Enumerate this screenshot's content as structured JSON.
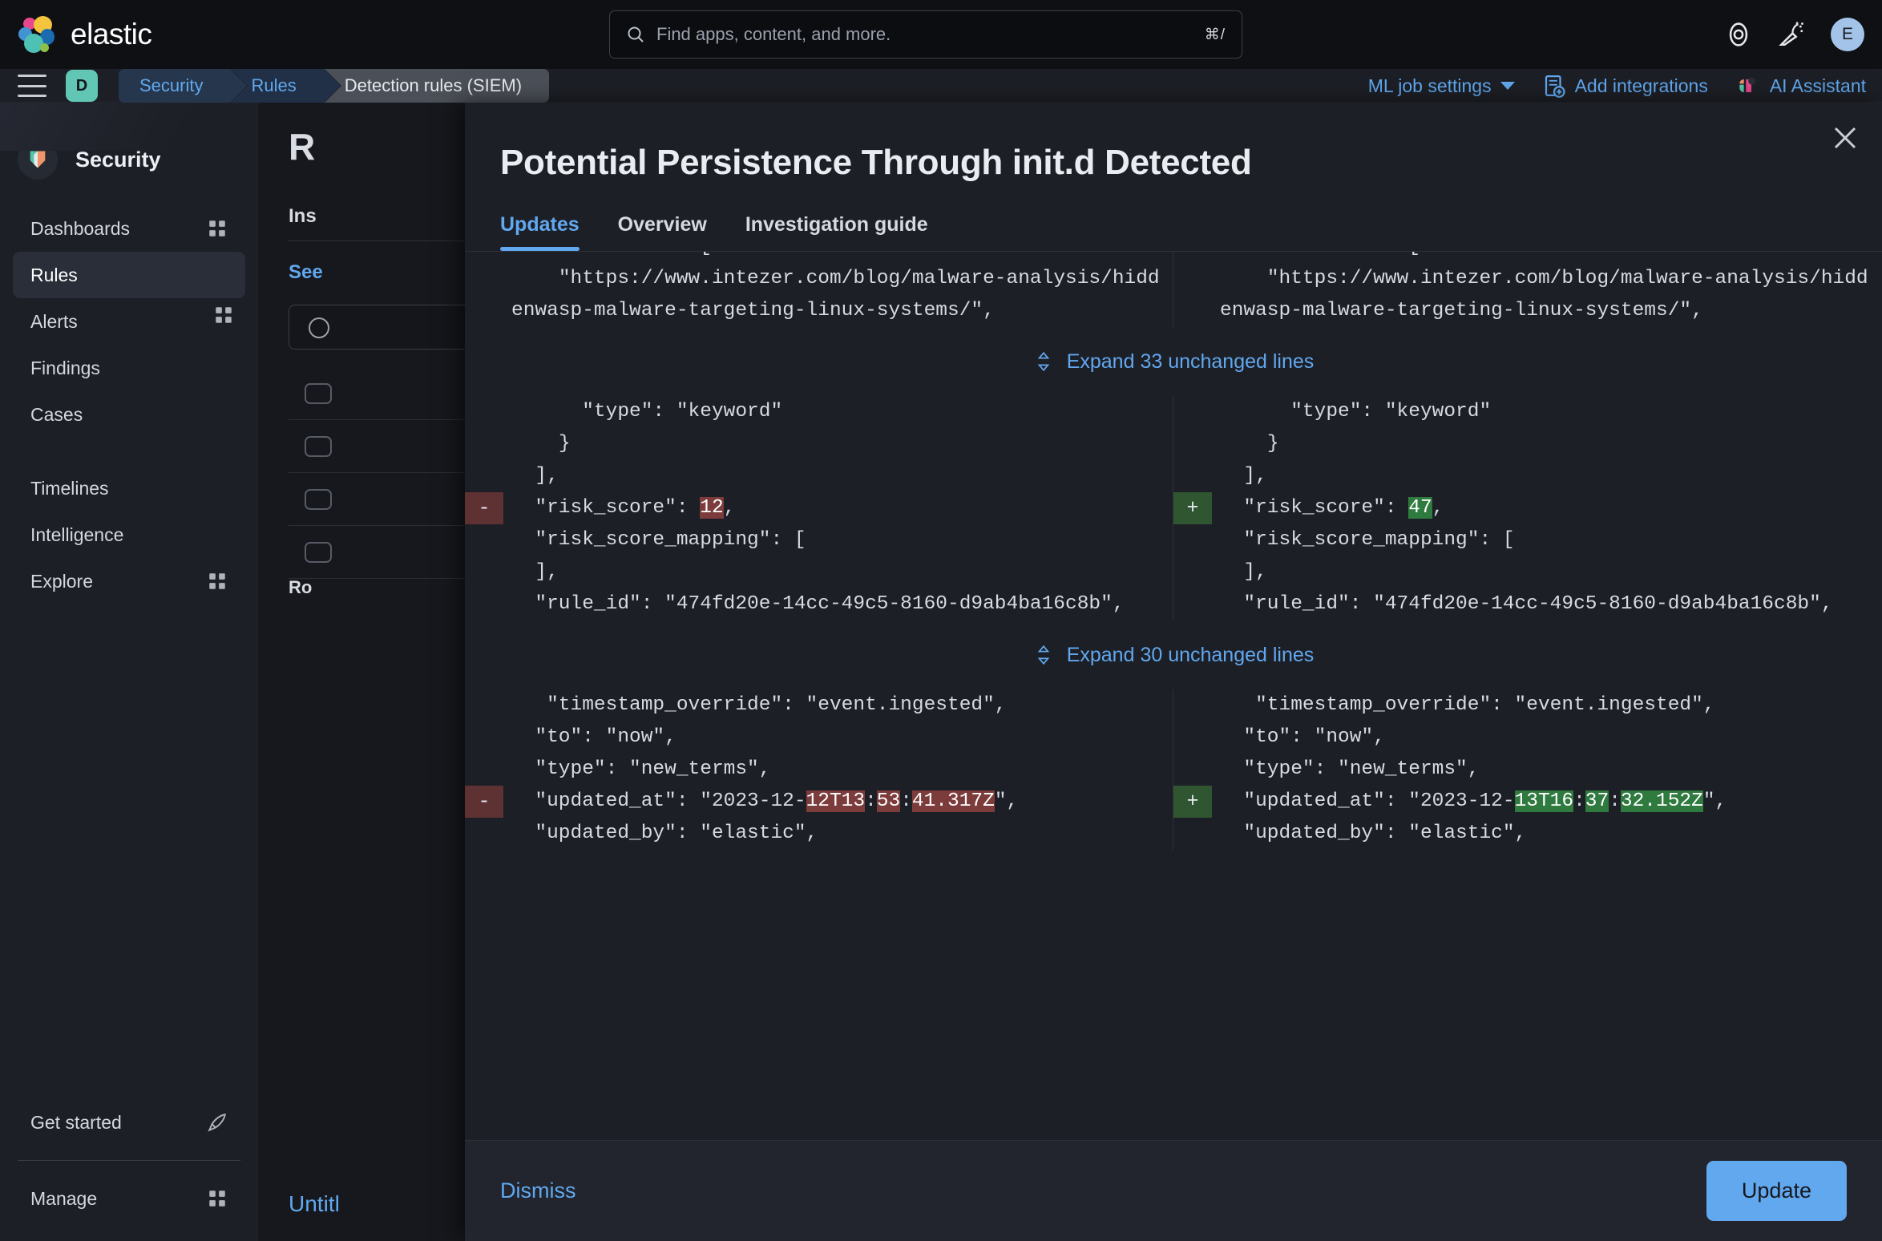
{
  "brand": {
    "name": "elastic",
    "logo_icon": "elastic-logo-icon"
  },
  "global_search": {
    "placeholder": "Find apps, content, and more.",
    "shortcut": "⌘/",
    "icon": "search-icon"
  },
  "top_right": {
    "help_icon": "help-circle-icon",
    "announcements_icon": "celebration-megaphone-icon",
    "avatar_initial": "E"
  },
  "breadcrumb": {
    "space_initial": "D",
    "menu_icon": "hamburger-menu-icon",
    "items": [
      {
        "label": "Security",
        "current": false
      },
      {
        "label": "Rules",
        "current": false
      },
      {
        "label": "Detection rules (SIEM)",
        "current": true
      }
    ],
    "actions": [
      {
        "label": "ML job settings",
        "icon": "chevron-down-icon"
      },
      {
        "label": "Add integrations",
        "icon": "add-integration-icon"
      },
      {
        "label": "AI Assistant",
        "icon": "ai-assistant-icon"
      }
    ]
  },
  "sidebar": {
    "title": "Security",
    "logo_icon": "security-shield-icon",
    "items": [
      {
        "label": "Dashboards",
        "icon": "apps-grid-icon",
        "active": false
      },
      {
        "label": "Rules",
        "icon": "apps-grid-icon",
        "active": true
      },
      {
        "label": "Alerts",
        "icon": "",
        "active": false
      },
      {
        "label": "Findings",
        "icon": "",
        "active": false
      },
      {
        "label": "Cases",
        "icon": "",
        "active": false
      },
      {
        "label": "Timelines",
        "icon": "",
        "active": false
      },
      {
        "label": "Intelligence",
        "icon": "",
        "active": false
      },
      {
        "label": "Explore",
        "icon": "apps-grid-icon",
        "active": false
      }
    ],
    "bottom_items": [
      {
        "label": "Get started",
        "icon": "rocket-icon"
      },
      {
        "label": "Manage",
        "icon": "apps-grid-icon"
      }
    ]
  },
  "background_page": {
    "heading": "R",
    "tab_label": "Ins",
    "link_label": "See",
    "table_footer": "Ro",
    "untitled_label": "Untitl"
  },
  "modal": {
    "title": "Potential Persistence Through init.d Detected",
    "close_icon": "close-icon",
    "tabs": [
      {
        "label": "Updates",
        "active": true
      },
      {
        "label": "Overview",
        "active": false
      },
      {
        "label": "Investigation guide",
        "active": false
      }
    ],
    "footer": {
      "dismiss_label": "Dismiss",
      "update_label": "Update"
    },
    "accent_color": "#61a8ef",
    "delete_color": "#5e3233",
    "add_color": "#2f5531"
  },
  "diff": {
    "expand_icon": "expand-vertical-icon",
    "rows": [
      {
        "kind": "context",
        "left": [
          {
            "t": "  \"references\": ["
          }
        ],
        "right": [
          {
            "t": "  \"references\": ["
          }
        ]
      },
      {
        "kind": "context",
        "left": [
          {
            "t": "    \"https://www.intezer.com/blog/malware-analysis/hiddenwasp-malware-targeting-linux-systems/\","
          }
        ],
        "right": [
          {
            "t": "    \"https://www.intezer.com/blog/malware-analysis/hiddenwasp-malware-targeting-linux-systems/\","
          }
        ]
      },
      {
        "kind": "expand",
        "label": "Expand 33 unchanged lines"
      },
      {
        "kind": "context",
        "left": [
          {
            "t": "      \"type\": \"keyword\""
          }
        ],
        "right": [
          {
            "t": "      \"type\": \"keyword\""
          }
        ]
      },
      {
        "kind": "context",
        "left": [
          {
            "t": "    }"
          }
        ],
        "right": [
          {
            "t": "    }"
          }
        ]
      },
      {
        "kind": "context",
        "left": [
          {
            "t": "  ],"
          }
        ],
        "right": [
          {
            "t": "  ],"
          }
        ]
      },
      {
        "kind": "change",
        "left_marker": "-",
        "right_marker": "+",
        "left": [
          {
            "t": "  \"risk_score\": "
          },
          {
            "t": "12",
            "hl": "del"
          },
          {
            "t": ","
          }
        ],
        "right": [
          {
            "t": "  \"risk_score\": "
          },
          {
            "t": "47",
            "hl": "add"
          },
          {
            "t": ","
          }
        ]
      },
      {
        "kind": "context",
        "left": [
          {
            "t": "  \"risk_score_mapping\": ["
          }
        ],
        "right": [
          {
            "t": "  \"risk_score_mapping\": ["
          }
        ]
      },
      {
        "kind": "context",
        "left": [
          {
            "t": "  ],"
          }
        ],
        "right": [
          {
            "t": "  ],"
          }
        ]
      },
      {
        "kind": "context",
        "left": [
          {
            "t": "  \"rule_id\": \"474fd20e-14cc-49c5-8160-d9ab4ba16c8b\","
          }
        ],
        "right": [
          {
            "t": "  \"rule_id\": \"474fd20e-14cc-49c5-8160-d9ab4ba16c8b\","
          }
        ]
      },
      {
        "kind": "expand",
        "label": "Expand 30 unchanged lines"
      },
      {
        "kind": "context",
        "left": [
          {
            "t": "   \"timestamp_override\": \"event.ingested\","
          }
        ],
        "right": [
          {
            "t": "   \"timestamp_override\": \"event.ingested\","
          }
        ]
      },
      {
        "kind": "context",
        "left": [
          {
            "t": "  \"to\": \"now\","
          }
        ],
        "right": [
          {
            "t": "  \"to\": \"now\","
          }
        ]
      },
      {
        "kind": "context",
        "left": [
          {
            "t": "  \"type\": \"new_terms\","
          }
        ],
        "right": [
          {
            "t": "  \"type\": \"new_terms\","
          }
        ]
      },
      {
        "kind": "change",
        "left_marker": "-",
        "right_marker": "+",
        "left": [
          {
            "t": "  \"updated_at\": \"2023-12-"
          },
          {
            "t": "12T13",
            "hl": "del"
          },
          {
            "t": ":"
          },
          {
            "t": "53",
            "hl": "del"
          },
          {
            "t": ":"
          },
          {
            "t": "41.317Z",
            "hl": "del"
          },
          {
            "t": "\","
          }
        ],
        "right": [
          {
            "t": "  \"updated_at\": \"2023-12-"
          },
          {
            "t": "13T16",
            "hl": "add"
          },
          {
            "t": ":"
          },
          {
            "t": "37",
            "hl": "add"
          },
          {
            "t": ":"
          },
          {
            "t": "32.152Z",
            "hl": "add"
          },
          {
            "t": "\","
          }
        ]
      },
      {
        "kind": "context",
        "left": [
          {
            "t": "  \"updated_by\": \"elastic\","
          }
        ],
        "right": [
          {
            "t": "  \"updated_by\": \"elastic\","
          }
        ]
      }
    ]
  }
}
